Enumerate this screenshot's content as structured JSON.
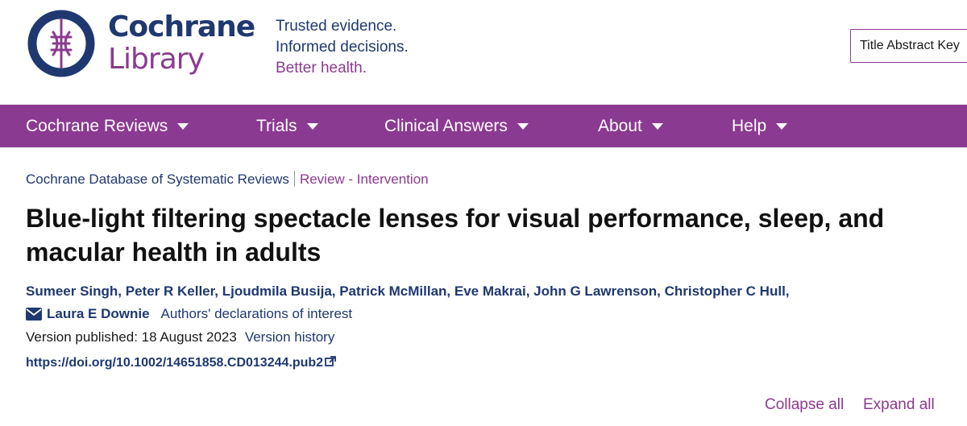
{
  "brand": {
    "name_line1": "Cochrane",
    "name_line2": "Library",
    "colors": {
      "navy": "#1f3870",
      "purple": "#8a3b8f",
      "nav_bg": "#8b3a91"
    }
  },
  "tagline": {
    "line1": "Trusted evidence.",
    "line2": "Informed decisions.",
    "line3": "Better health."
  },
  "search": {
    "value": "Title Abstract Key"
  },
  "nav": {
    "items": [
      {
        "label": "Cochrane Reviews"
      },
      {
        "label": "Trials"
      },
      {
        "label": "Clinical Answers"
      },
      {
        "label": "About"
      },
      {
        "label": "Help"
      }
    ]
  },
  "breadcrumb": {
    "database": "Cochrane Database of Systematic Reviews",
    "review_type": "Review - Intervention"
  },
  "article": {
    "title": "Blue-light filtering spectacle lenses for visual performance, sleep, and macular health in adults",
    "authors_line1": "Sumeer Singh, Peter R Keller, Ljoudmila Busija, Patrick McMillan, Eve Makrai, John G Lawrenson, Christopher C Hull,",
    "contact_author": "Laura E Downie",
    "declarations": "Authors' declarations of interest",
    "version_published": "Version published: 18 August 2023",
    "version_history": "Version history",
    "doi": "https://doi.org/10.1002/14651858.CD013244.pub2"
  },
  "controls": {
    "collapse_all": "Collapse all",
    "expand_all": "Expand all"
  },
  "icons": [
    "cochrane-logo-icon",
    "caret-down-icon",
    "envelope-icon",
    "external-link-icon"
  ]
}
